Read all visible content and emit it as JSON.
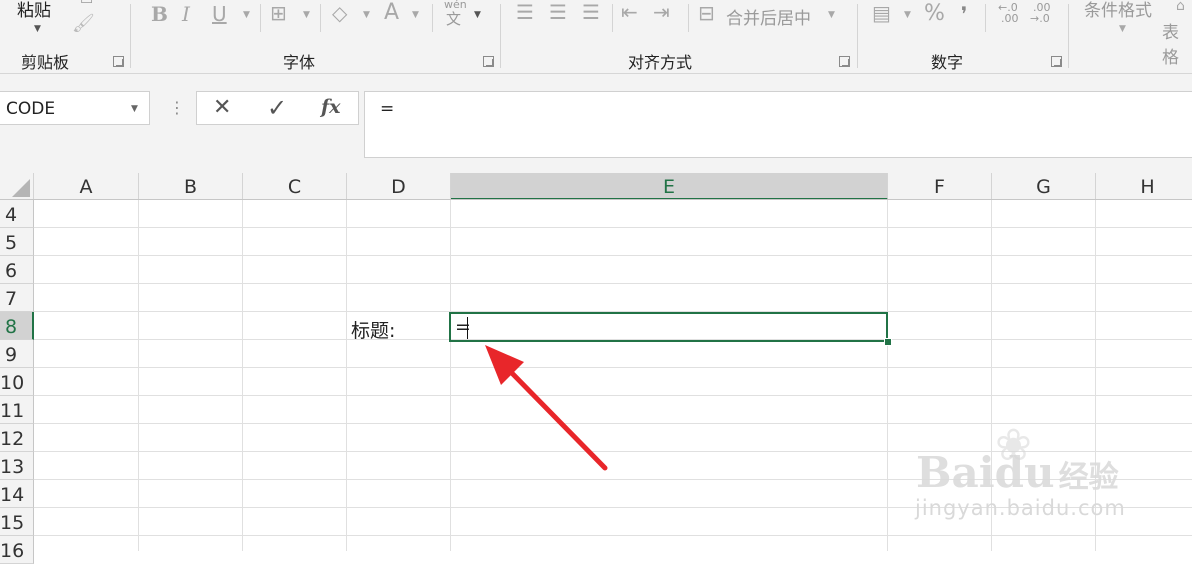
{
  "ribbon": {
    "paste_label": "粘贴",
    "groups": {
      "clipboard": "剪贴板",
      "font": "字体",
      "alignment": "对齐方式",
      "number": "数字"
    },
    "buttons": {
      "bold": "B",
      "italic": "I",
      "underline": "U",
      "font_color": "A",
      "phonetic_top": "wén",
      "phonetic_bottom": "文",
      "merge_center": "合并后居中",
      "percent": "%",
      "comma": "❜",
      "inc_decimal_top": "←.0",
      "inc_decimal_bottom": ".00",
      "dec_decimal_top": ".00",
      "dec_decimal_bottom": "→.0",
      "conditional_format": "条件格式",
      "table_format": "表格"
    }
  },
  "formula_bar": {
    "name_box": "CODE",
    "cancel_icon": "✕",
    "enter_icon": "✓",
    "fx_label": "fx",
    "content": "="
  },
  "grid": {
    "columns": [
      "A",
      "B",
      "C",
      "D",
      "E",
      "F",
      "G",
      "H"
    ],
    "rows": [
      "4",
      "5",
      "6",
      "7",
      "8",
      "9",
      "10",
      "11",
      "12",
      "13",
      "14",
      "15",
      "16"
    ],
    "selected_column": "E",
    "selected_row": "8",
    "cells": {
      "D8": "标题:",
      "E8": "="
    }
  },
  "watermark": {
    "brand": "Baidu",
    "brand_cn": "经验",
    "url": "jingyan.baidu.com"
  },
  "colors": {
    "excel_green": "#217346",
    "arrow_red": "#e8262a"
  }
}
